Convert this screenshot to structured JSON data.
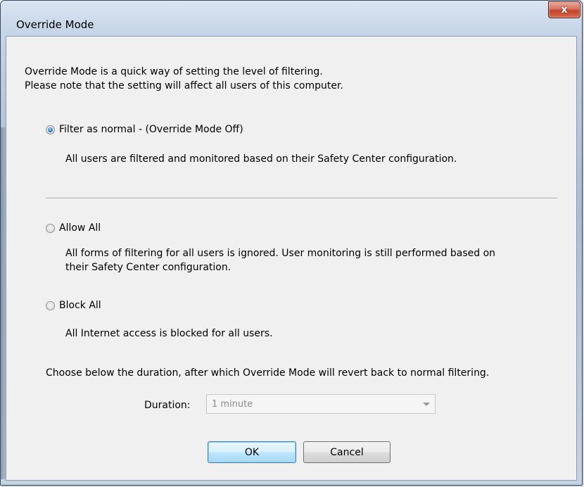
{
  "window": {
    "title": "Override Mode",
    "close_glyph": "x"
  },
  "intro": {
    "line1": "Override Mode is a quick way of setting the level of filtering.",
    "line2": "Please note that the setting will affect all users of this computer."
  },
  "options": [
    {
      "label": "Filter as normal - (Override Mode Off)",
      "checked": true,
      "description_lines": [
        "All users are filtered and monitored based on their Safety Center configuration."
      ]
    },
    {
      "label": "Allow All",
      "checked": false,
      "description_lines": [
        "All forms of filtering for all users is ignored. User monitoring is still performed based on",
        "their Safety Center configuration."
      ]
    },
    {
      "label": "Block All",
      "checked": false,
      "description_lines": [
        "All Internet access is blocked for all users."
      ]
    }
  ],
  "duration": {
    "instruction": "Choose below the duration, after which Override Mode will revert back to normal filtering.",
    "label": "Duration:",
    "selected_value": "1 minute",
    "enabled": false
  },
  "buttons": {
    "ok_label": "OK",
    "cancel_label": "Cancel"
  },
  "icons": {
    "close": "close-icon",
    "dropdown": "chevron-down-icon"
  }
}
